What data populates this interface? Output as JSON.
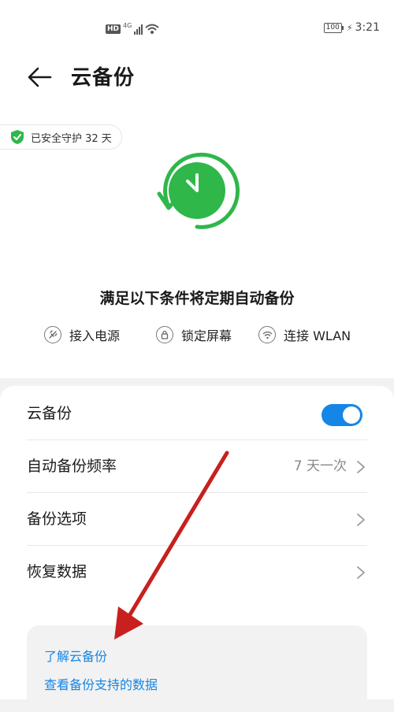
{
  "status_bar": {
    "hd_label": "HD",
    "network_label": "4G",
    "battery": "100",
    "time": "3:21"
  },
  "header": {
    "title": "云备份"
  },
  "badge": {
    "text": "已安全守护 32 天",
    "color": "#2fb74a"
  },
  "conditions": {
    "title": "满足以下条件将定期自动备份",
    "items": [
      {
        "label": "接入电源",
        "icon": "power-plug-icon"
      },
      {
        "label": "锁定屏幕",
        "icon": "lock-icon"
      },
      {
        "label": "连接 WLAN",
        "icon": "wifi-icon"
      }
    ]
  },
  "settings": {
    "cloud_backup": {
      "label": "云备份",
      "enabled": true
    },
    "frequency": {
      "label": "自动备份频率",
      "value": "7 天一次"
    },
    "options": {
      "label": "备份选项"
    },
    "restore": {
      "label": "恢复数据"
    }
  },
  "learn_more": {
    "link1": "了解云备份",
    "link2": "查看备份支持的数据"
  },
  "colors": {
    "accent": "#1486e6",
    "green": "#2fb74a",
    "annotation_arrow": "#c8201e"
  }
}
